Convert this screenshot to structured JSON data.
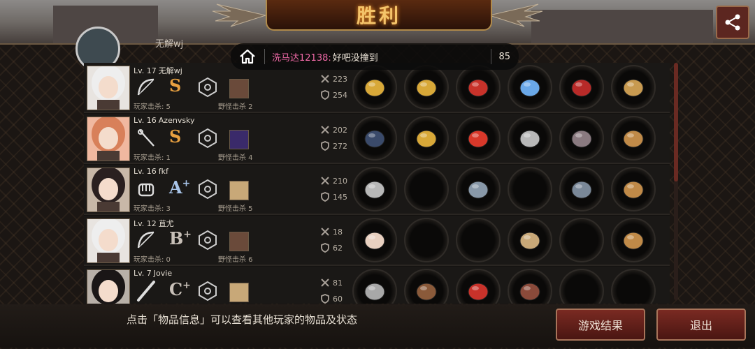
{
  "header": {
    "title": "胜利",
    "top_player_name": "无解wj"
  },
  "chat": {
    "user": "洗马达12138:",
    "message": "好吧没撞到",
    "count": "85"
  },
  "players": [
    {
      "level": "Lv. 17",
      "name": "无解wj",
      "grade": "S",
      "grade_sup": "",
      "player_kills_label": "玩家击杀: 5",
      "mob_kills_label": "野怪击杀 2",
      "attack": "223",
      "defense": "254",
      "weapon": "bow-icon",
      "items": [
        "golden-tiara-icon",
        "royal-crown-icon",
        "red-jacket-icon",
        "blue-gauntlet-icon",
        "red-heels-icon",
        "pocket-watch-icon"
      ]
    },
    {
      "level": "Lv. 16",
      "name": "Azenvsky",
      "grade": "S",
      "grade_sup": "",
      "player_kills_label": "玩家击杀: 1",
      "mob_kills_label": "野怪击杀 4",
      "attack": "202",
      "defense": "272",
      "weapon": "rapier-icon",
      "items": [
        "dark-sword-icon",
        "royal-crown-icon",
        "red-dress-icon",
        "spiked-bracer-icon",
        "leather-boots-icon",
        "supply-crate-icon"
      ]
    },
    {
      "level": "Lv. 16",
      "name": "fkf",
      "grade": "A",
      "grade_sup": "+",
      "player_kills_label": "玩家击杀: 3",
      "mob_kills_label": "野怪击杀 5",
      "attack": "210",
      "defense": "145",
      "weapon": "fist-icon",
      "items": [
        "steel-gauntlet-icon",
        "empty-slot",
        "chainmail-icon",
        "empty-slot",
        "armored-boots-icon",
        "supply-crate-icon"
      ]
    },
    {
      "level": "Lv. 12",
      "name": "苴尤",
      "grade": "B",
      "grade_sup": "+",
      "player_kills_label": "玩家击杀: 0",
      "mob_kills_label": "野怪击杀 6",
      "attack": "18",
      "defense": "62",
      "weapon": "bow-icon",
      "items": [
        "wooden-bow-icon",
        "empty-slot",
        "empty-slot",
        "wristwatch-icon",
        "empty-slot",
        "supply-crate-icon"
      ]
    },
    {
      "level": "Lv. 7",
      "name": "Jovie",
      "grade": "C",
      "grade_sup": "+",
      "player_kills_label": "",
      "mob_kills_label": "",
      "attack": "81",
      "defense": "60",
      "weapon": "bat-icon",
      "items": [
        "iron-rod-icon",
        "bracelet-icon",
        "red-cloth-icon",
        "shield-icon",
        "empty-slot",
        "empty-slot"
      ]
    }
  ],
  "footer": {
    "hint": "点击「物品信息」可以查看其他玩家的物品及状态",
    "result_button": "游戏结果",
    "exit_button": "退出"
  },
  "colors": {
    "accent": "#e8a040",
    "button": "#6a2620",
    "chat_user": "#f06aa8"
  }
}
